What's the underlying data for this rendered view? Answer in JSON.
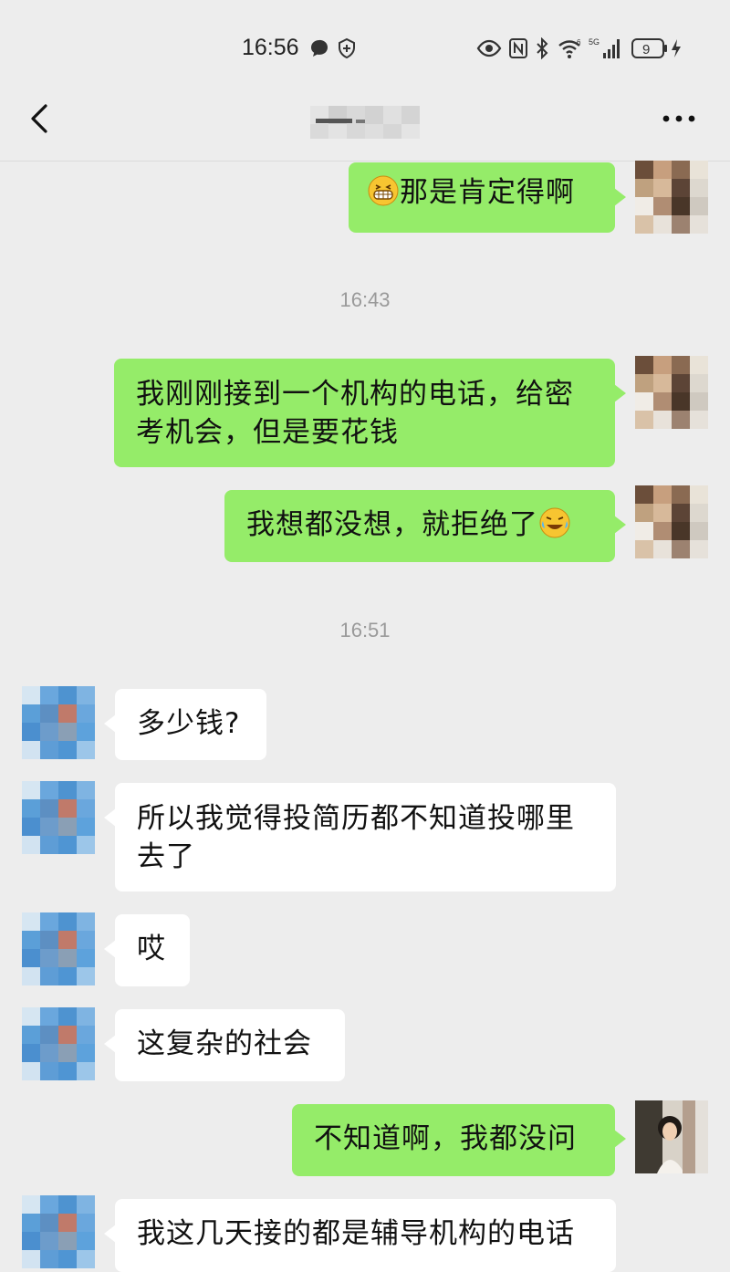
{
  "status_bar": {
    "time": "16:56",
    "battery_level": "9",
    "icons": [
      "chat-bubble-icon",
      "shield-icon",
      "eye-icon",
      "nfc-icon",
      "bluetooth-icon",
      "wifi-icon",
      "signal-5g-icon",
      "battery-icon",
      "charging-icon"
    ]
  },
  "nav": {
    "back_icon": "chevron-left-icon",
    "more_label": "···"
  },
  "messages": [
    {
      "side": "me",
      "text": "那是肯定得啊",
      "emoji_before": "grin-emoji"
    },
    {
      "type": "timestamp",
      "text": "16:43"
    },
    {
      "side": "me",
      "lines": [
        "我刚刚接到一个机构的电话，给密",
        "考机会，但是要花钱"
      ]
    },
    {
      "side": "me",
      "text": "我想都没想，就拒绝了",
      "emoji_after": "laugh-cry-emoji"
    },
    {
      "type": "timestamp",
      "text": "16:51"
    },
    {
      "side": "other",
      "text": "多少钱?"
    },
    {
      "side": "other",
      "lines": [
        "所以我觉得投简历都不知道投哪里",
        "去了"
      ]
    },
    {
      "side": "other",
      "text": "哎"
    },
    {
      "side": "other",
      "text": "这复杂的社会"
    },
    {
      "side": "me",
      "text": "不知道啊，我都没问"
    },
    {
      "side": "other",
      "text": "我这几天接的都是辅导机构的电话"
    }
  ],
  "colors": {
    "background": "#ededed",
    "my_bubble": "#95ec69",
    "other_bubble": "#ffffff",
    "timestamp": "#9a9a9a"
  }
}
